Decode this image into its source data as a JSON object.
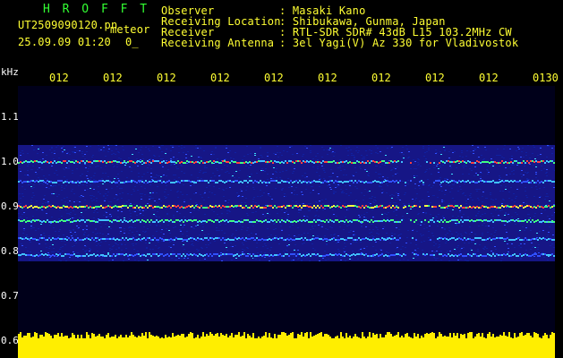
{
  "header": {
    "station": "H R O F F T",
    "filename": "UT2509090120.pn",
    "meteor_label": "meteor",
    "datetime": "25.09.09 01:20",
    "count": "0_",
    "fields": [
      {
        "label": "Observer",
        "value": ": Masaki Kano"
      },
      {
        "label": "Receiving Location",
        "value": ": Shibukawa, Gunma, Japan"
      },
      {
        "label": "Receiver",
        "value": ": RTL-SDR SDR# 43dB L15 103.2MHz CW"
      },
      {
        "label": "Receiving Antenna",
        "value": ": 3el Yagi(V) Az 330 for Vladivostok"
      }
    ]
  },
  "spectrogram": {
    "unit_label": "kHz",
    "time_ticks": [
      "012",
      "012",
      "012",
      "012",
      "012",
      "012",
      "012",
      "012",
      "012",
      "0130"
    ],
    "freq_labels": [
      "1.1",
      "1.0",
      "0.9",
      "0.8",
      "0.7",
      "0.6"
    ],
    "freq_range_khz": [
      0.6,
      1.12
    ],
    "colors": {
      "background": "#00001a",
      "noise": "#2020c8",
      "tick_text": "#ffff33",
      "level_bar": "#ffee00"
    }
  }
}
